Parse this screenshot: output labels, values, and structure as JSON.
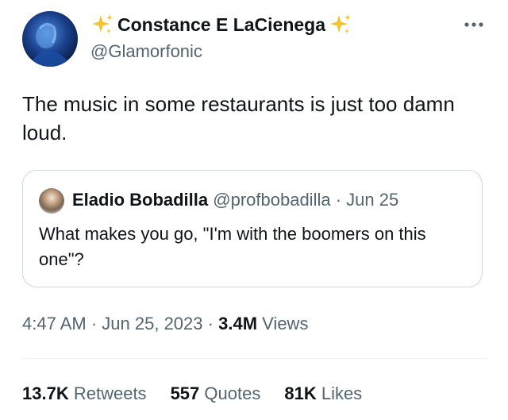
{
  "author": {
    "display_name": "Constance E LaCienega",
    "handle": "@Glamorfonic",
    "name_emoji": "sparkles-icon"
  },
  "tweet": {
    "text": "The music in some restaurants is just too damn loud."
  },
  "quoted_tweet": {
    "author_name": "Eladio Bobadilla",
    "handle": "@profbobadilla",
    "separator": "·",
    "date": "Jun 25",
    "text": "What makes you go, \"I'm with the boomers on this one\"?"
  },
  "meta": {
    "time": "4:47 AM",
    "separator": "·",
    "date": "Jun 25, 2023",
    "views_count": "3.4M",
    "views_label": "Views"
  },
  "stats": {
    "retweets_count": "13.7K",
    "retweets_label": "Retweets",
    "quotes_count": "557",
    "quotes_label": "Quotes",
    "likes_count": "81K",
    "likes_label": "Likes"
  },
  "colors": {
    "text_primary": "#0f1419",
    "text_secondary": "#536471",
    "border": "#cfd9de",
    "sparkle": "#f4c430"
  }
}
